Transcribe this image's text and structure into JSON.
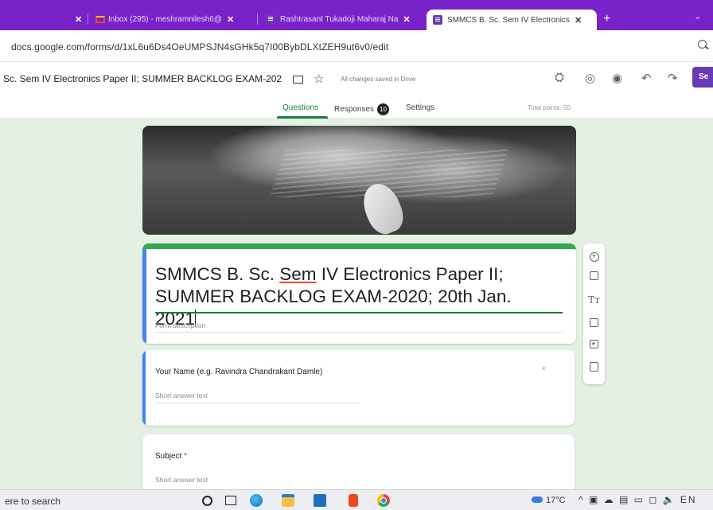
{
  "browser": {
    "tabs": [
      {
        "label": "",
        "close": "✕"
      },
      {
        "label": "Inbox (295) - meshramnilesh6@",
        "close": "✕"
      },
      {
        "label": "Rashtrasant Tukadoji Maharaj Na",
        "close": "✕"
      },
      {
        "label": "SMMCS B. Sc. Sem IV Electronics",
        "close": "✕"
      }
    ],
    "new_tab": "+",
    "chevron": "⌄",
    "url": "docs.google.com/forms/d/1xL6u6Ds4OeUMPSJN4sGHk5q7I00BybDLXtZEH9ut6v0/edit"
  },
  "forms_header": {
    "title": "Sc. Sem IV Electronics Paper II; SUMMER BACKLOG EXAM-202",
    "saved_status": "All changes saved in Drive",
    "send_label": "Se",
    "nav_tabs": [
      {
        "label": "Questions"
      },
      {
        "label": "Responses",
        "badge": "10"
      },
      {
        "label": "Settings"
      }
    ],
    "total_points": "Total points: 50",
    "icons": [
      "customize-icon",
      "palette-icon",
      "preview-icon",
      "undo-icon",
      "redo-icon"
    ]
  },
  "form": {
    "title_pre": "SMMCS B. Sc. ",
    "title_sem": "Sem",
    "title_post": " IV Electronics Paper II; SUMMER BACKLOG EXAM-2020; 20th Jan. 2021",
    "description_placeholder": "Form description",
    "questions": [
      {
        "text": "Your Name (e.g. Ravindra Chandrakant Damle)",
        "placeholder": "Short answer text",
        "required_mark": "*"
      },
      {
        "text": "Subject",
        "required_mark": "*",
        "placeholder": "Short answer text"
      }
    ]
  },
  "side_toolbar": {
    "tools": [
      "add-question-icon",
      "import-questions-icon",
      "add-title-icon",
      "add-image-icon",
      "add-video-icon",
      "add-section-icon"
    ],
    "title_tool_label": "Tт"
  },
  "taskbar": {
    "search_text": "ere to search",
    "weather": "17°C",
    "tray_text": "^ ▣ ☁ ▤ ▭ ◻ 🔈 EN"
  }
}
